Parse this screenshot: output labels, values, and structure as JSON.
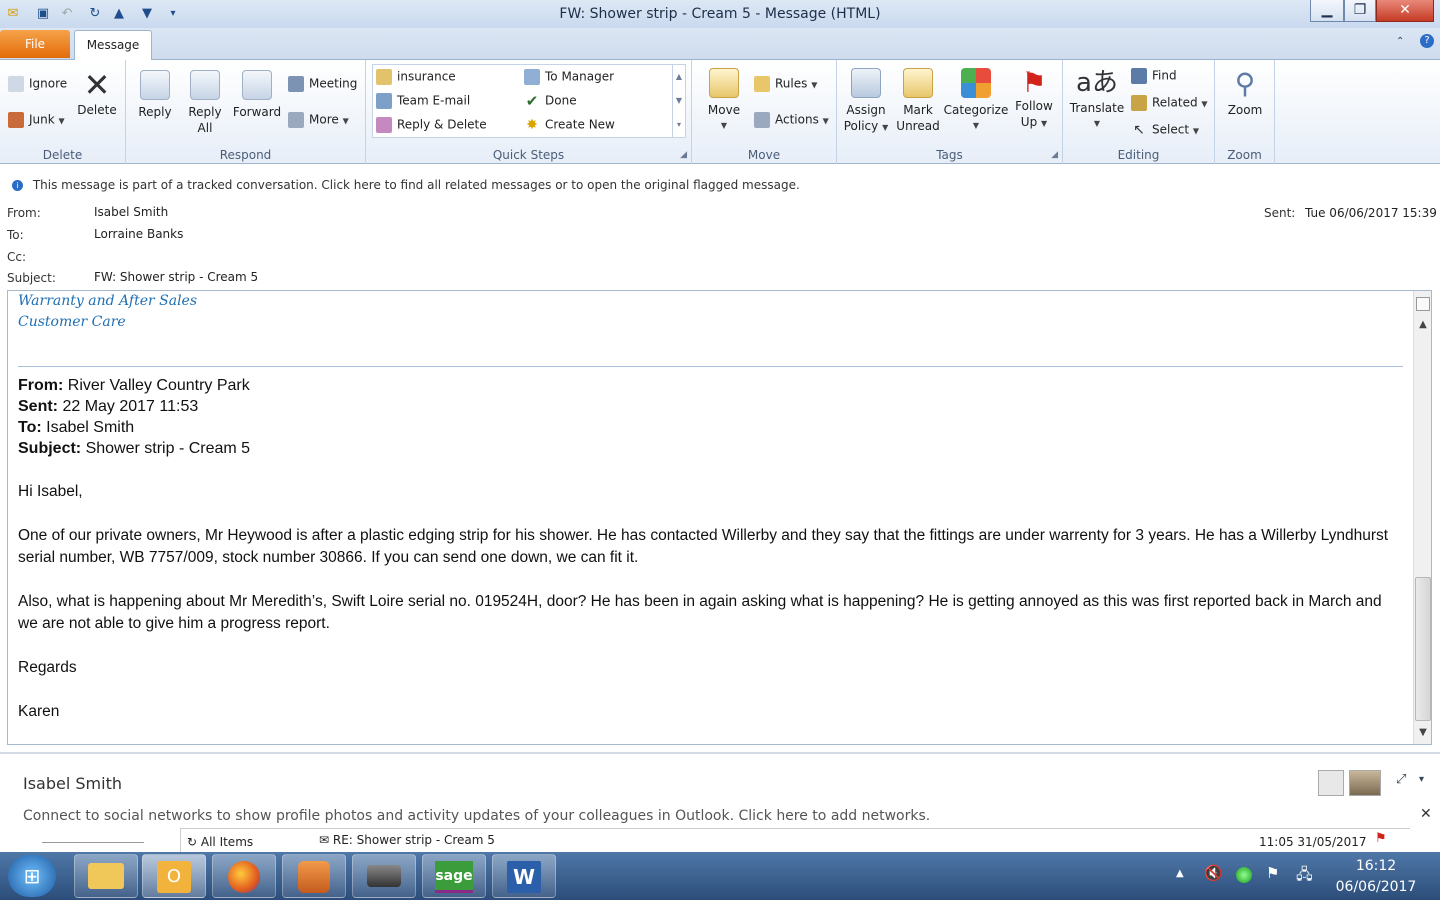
{
  "window": {
    "title": "FW: Shower strip - Cream 5  -  Message (HTML)"
  },
  "tabs": {
    "file": "File",
    "message": "Message"
  },
  "ribbon": {
    "delete": {
      "ignore": "Ignore",
      "junk": "Junk",
      "delete": "Delete",
      "group": "Delete"
    },
    "respond": {
      "reply": "Reply",
      "reply_all_1": "Reply",
      "reply_all_2": "All",
      "forward": "Forward",
      "meeting": "Meeting",
      "more": "More",
      "group": "Respond"
    },
    "quick_steps": {
      "items": [
        "insurance",
        "Team E-mail",
        "Reply & Delete",
        "To Manager",
        "Done",
        "Create New"
      ],
      "group": "Quick Steps"
    },
    "move": {
      "move": "Move",
      "rules": "Rules",
      "actions": "Actions",
      "group": "Move"
    },
    "tags": {
      "assign_1": "Assign",
      "assign_2": "Policy",
      "mark_1": "Mark",
      "mark_2": "Unread",
      "categorize": "Categorize",
      "follow_1": "Follow",
      "follow_2": "Up",
      "group": "Tags"
    },
    "editing": {
      "translate": "Translate",
      "find": "Find",
      "related": "Related",
      "select": "Select",
      "group": "Editing"
    },
    "zoom": {
      "zoom": "Zoom",
      "group": "Zoom"
    }
  },
  "infobar": "This message is part of a tracked conversation. Click here to find all related messages or to open the original flagged message.",
  "header": {
    "from_label": "From:",
    "from": "Isabel Smith",
    "to_label": "To:",
    "to": "Lorraine Banks",
    "cc_label": "Cc:",
    "subject_label": "Subject:",
    "subject": "FW: Shower strip - Cream 5",
    "sent_label": "Sent:",
    "sent": "Tue 06/06/2017 15:39"
  },
  "body": {
    "sig_line1": "Warranty and After Sales",
    "sig_line2": "Customer Care",
    "fwd_from_label": "From:",
    "fwd_from": " River Valley Country Park",
    "fwd_sent_label": "Sent:",
    "fwd_sent": " 22 May 2017 11:53",
    "fwd_to_label": "To:",
    "fwd_to": " Isabel Smith",
    "fwd_subject_label": "Subject:",
    "fwd_subject": " Shower strip - Cream 5",
    "greeting": "Hi Isabel,",
    "para1": "One of our private owners, Mr Heywood is after a plastic edging strip for his shower.  He has contacted Willerby and they say that the fittings are under warrenty for 3 years.  He has a Willerby Lyndhurst serial number, WB 7757/009, stock number 30866.  If you can send one down, we can fit it.",
    "para2": "Also, what is happening about Mr Meredith’s, Swift Loire serial no. 019524H, door?  He has been in again asking what is happening?  He is getting annoyed as this was first reported back in March and we are not able to give him a progress report.",
    "regards": "Regards",
    "sign": "Karen"
  },
  "people_pane": {
    "name": "Isabel Smith",
    "social": "Connect to social networks to show profile photos and activity updates of your colleagues in Outlook. Click here to add networks.",
    "all_items": "All Items",
    "related_subject": "RE: Shower strip - Cream 5",
    "related_date": "11:05 31/05/2017"
  },
  "taskbar": {
    "time": "16:12",
    "date": "06/06/2017"
  }
}
